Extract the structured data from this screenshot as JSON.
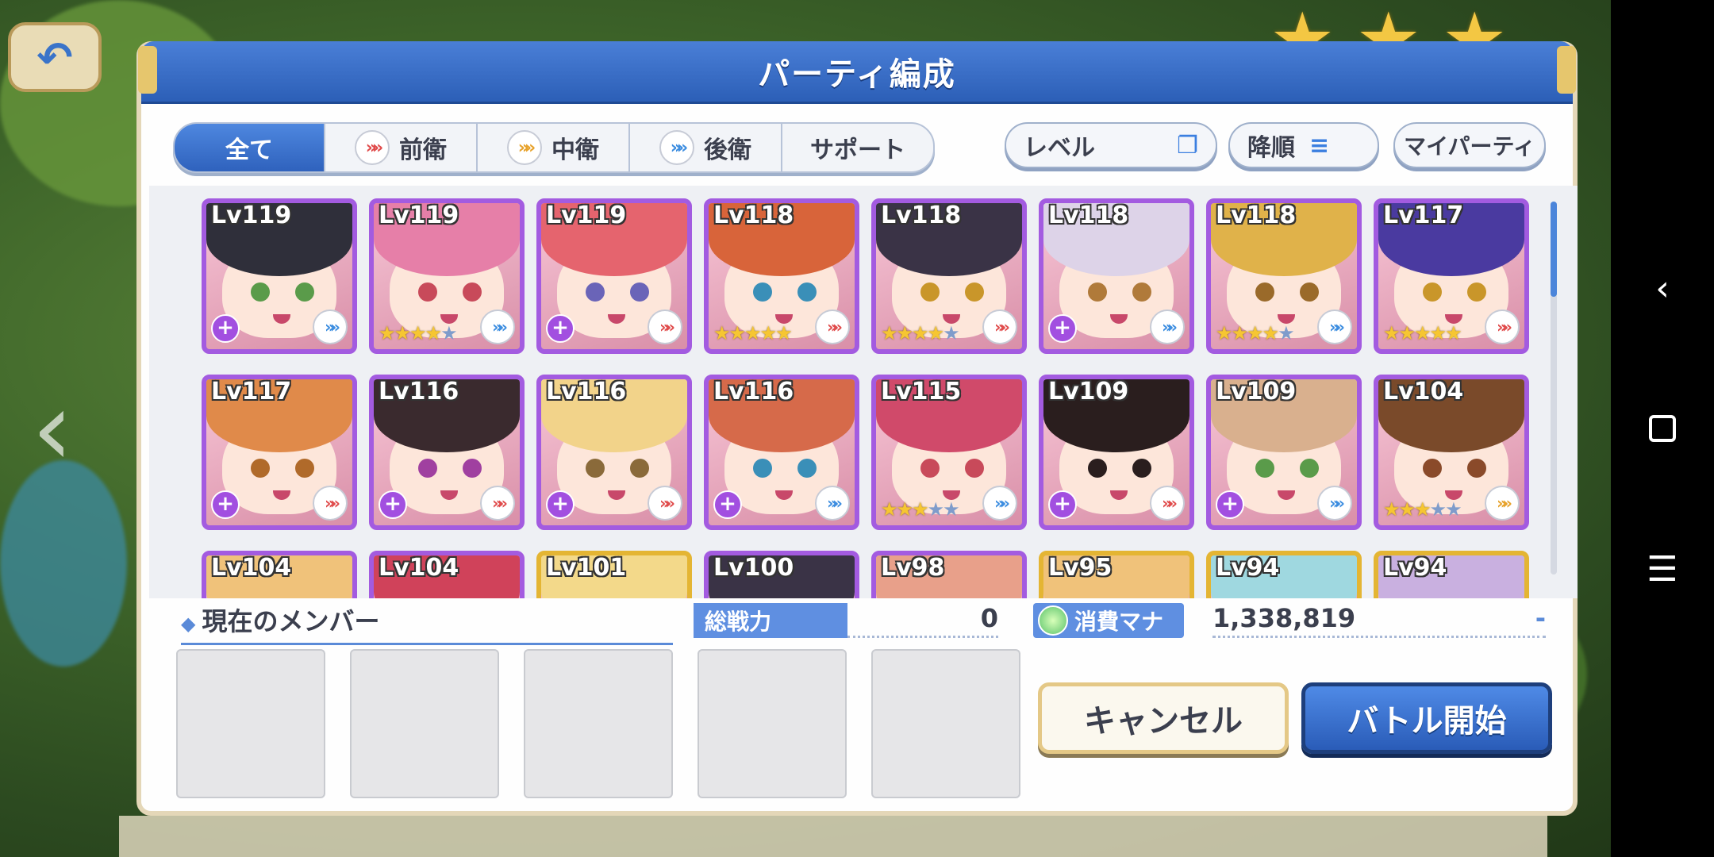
{
  "dialog": {
    "title": "パーティ編成"
  },
  "tabs": [
    {
      "label": "全て",
      "active": true,
      "icon": ""
    },
    {
      "label": "前衛",
      "active": false,
      "icon": "front-role-icon"
    },
    {
      "label": "中衛",
      "active": false,
      "icon": "middle-role-icon"
    },
    {
      "label": "後衛",
      "active": false,
      "icon": "back-role-icon"
    },
    {
      "label": "サポート",
      "active": false,
      "icon": ""
    }
  ],
  "sort": {
    "level_label": "レベル",
    "order_label": "降順",
    "my_party_label": "マイパーティ"
  },
  "characters": [
    {
      "level": "Lv119",
      "stars": 0,
      "plus": true,
      "role": "back",
      "hair": "#2f2f3a",
      "eye": "#5a9b4a",
      "frame": "purple"
    },
    {
      "level": "Lv119",
      "stars": 4,
      "plus": false,
      "role": "back",
      "hair": "#e67fa8",
      "eye": "#c84a5a",
      "frame": "purple"
    },
    {
      "level": "Lv119",
      "stars": 0,
      "plus": true,
      "role": "front",
      "hair": "#e5646e",
      "eye": "#6a64b8",
      "frame": "purple"
    },
    {
      "level": "Lv118",
      "stars": 5,
      "plus": false,
      "role": "front",
      "hair": "#d8643a",
      "eye": "#3a8fb8",
      "frame": "purple"
    },
    {
      "level": "Lv118",
      "stars": 4,
      "plus": false,
      "role": "front",
      "hair": "#3a3346",
      "eye": "#c9962a",
      "frame": "purple"
    },
    {
      "level": "Lv118",
      "stars": 0,
      "plus": true,
      "role": "back",
      "hair": "#ddd3e8",
      "eye": "#b07a3a",
      "frame": "purple"
    },
    {
      "level": "Lv118",
      "stars": 4,
      "plus": false,
      "role": "back",
      "hair": "#e0b24a",
      "eye": "#9a6a2a",
      "frame": "purple"
    },
    {
      "level": "Lv117",
      "stars": 5,
      "plus": false,
      "role": "front",
      "hair": "#4a3aa0",
      "eye": "#c9962a",
      "frame": "purple"
    },
    {
      "level": "Lv117",
      "stars": 0,
      "plus": true,
      "role": "front",
      "hair": "#e08a4a",
      "eye": "#b06a2a",
      "frame": "purple"
    },
    {
      "level": "Lv116",
      "stars": 0,
      "plus": true,
      "role": "front",
      "hair": "#3a2a2e",
      "eye": "#a040a0",
      "frame": "purple"
    },
    {
      "level": "Lv116",
      "stars": 0,
      "plus": true,
      "role": "front",
      "hair": "#f2d38a",
      "eye": "#8a6a3a",
      "frame": "purple"
    },
    {
      "level": "Lv116",
      "stars": 0,
      "plus": true,
      "role": "back",
      "hair": "#d66a4a",
      "eye": "#3a8fb8",
      "frame": "purple"
    },
    {
      "level": "Lv115",
      "stars": 3,
      "plus": false,
      "role": "back",
      "hair": "#d04a6a",
      "eye": "#c84a5a",
      "frame": "purple"
    },
    {
      "level": "Lv109",
      "stars": 0,
      "plus": true,
      "role": "front",
      "hair": "#2a1e1e",
      "eye": "#2a1e1e",
      "frame": "purple"
    },
    {
      "level": "Lv109",
      "stars": 0,
      "plus": true,
      "role": "back",
      "hair": "#d9b08e",
      "eye": "#5a9b4a",
      "frame": "purple"
    },
    {
      "level": "Lv104",
      "stars": 3,
      "plus": false,
      "role": "middle",
      "hair": "#7a4a2a",
      "eye": "#8a4a2a",
      "frame": "purple"
    },
    {
      "level": "Lv104",
      "stars": 0,
      "plus": false,
      "role": "none",
      "hair": "#f0c27a",
      "eye": "#8a6a3a",
      "frame": "purple"
    },
    {
      "level": "Lv104",
      "stars": 0,
      "plus": false,
      "role": "none",
      "hair": "#d0425a",
      "eye": "#8a3a3a",
      "frame": "purple"
    },
    {
      "level": "Lv101",
      "stars": 0,
      "plus": false,
      "role": "none",
      "hair": "#f3d98a",
      "eye": "#8a6a3a",
      "frame": "gold"
    },
    {
      "level": "Lv100",
      "stars": 0,
      "plus": false,
      "role": "none",
      "hair": "#3a3346",
      "eye": "#6a6a8a",
      "frame": "purple"
    },
    {
      "level": "Lv98",
      "stars": 0,
      "plus": false,
      "role": "none",
      "hair": "#e8a08a",
      "eye": "#8a4a3a",
      "frame": "purple"
    },
    {
      "level": "Lv95",
      "stars": 0,
      "plus": false,
      "role": "none",
      "hair": "#f0c27a",
      "eye": "#8a6a3a",
      "frame": "gold"
    },
    {
      "level": "Lv94",
      "stars": 0,
      "plus": false,
      "role": "none",
      "hair": "#9fd8e0",
      "eye": "#3a8fb8",
      "frame": "gold"
    },
    {
      "level": "Lv94",
      "stars": 0,
      "plus": false,
      "role": "none",
      "hair": "#c9b0e0",
      "eye": "#7a5aa0",
      "frame": "gold"
    }
  ],
  "bottom": {
    "members_label": "現在のメンバー",
    "power_label": "総戦力",
    "power_value": "0",
    "mana_label": "消費マナ",
    "mana_value": "1,338,819",
    "mana_dash": "-",
    "cancel_label": "キャンセル",
    "start_label": "バトル開始"
  },
  "android_nav": {
    "back": "‹",
    "menu": "☰"
  },
  "colors": {
    "accent": "#2f62bd",
    "frame_purple": "#a35be0",
    "frame_gold": "#e4b533"
  }
}
